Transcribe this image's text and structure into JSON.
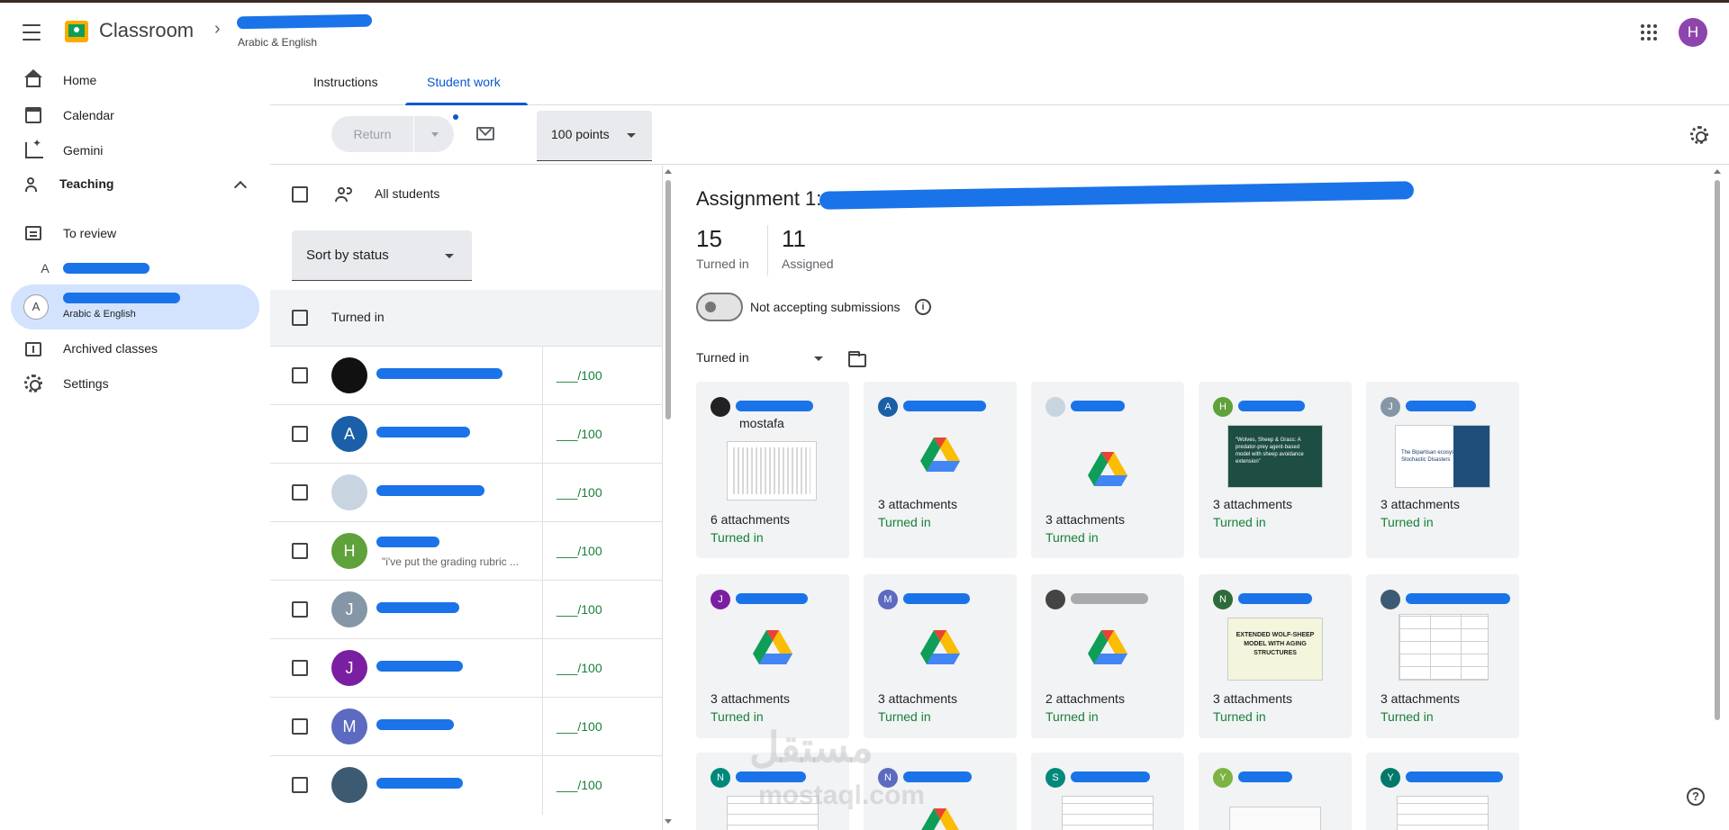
{
  "header": {
    "app_title": "Classroom",
    "class_subtitle": "Arabic & English",
    "avatar_initial": "H"
  },
  "sidebar": {
    "home": "Home",
    "calendar": "Calendar",
    "gemini": "Gemini",
    "teaching": "Teaching",
    "to_review": "To review",
    "class1_initial": "A",
    "class2_initial": "A",
    "class2_subtitle": "Arabic & English",
    "archived": "Archived classes",
    "settings": "Settings"
  },
  "tabs": {
    "instructions": "Instructions",
    "student_work": "Student work"
  },
  "toolbar": {
    "return_label": "Return",
    "points_label": "100 points"
  },
  "student_list": {
    "all_students": "All students",
    "sort_label": "Sort by status",
    "group_label": "Turned in",
    "rows": [
      {
        "initial": "",
        "color": "#111111",
        "grade": "___/100",
        "comment": ""
      },
      {
        "initial": "A",
        "color": "#1a5fa8",
        "grade": "___/100",
        "comment": ""
      },
      {
        "initial": "",
        "color": "#c8d4e0",
        "grade": "___/100",
        "comment": ""
      },
      {
        "initial": "H",
        "color": "#5fa13a",
        "grade": "___/100",
        "comment": "\"i've put the grading rubric ..."
      },
      {
        "initial": "J",
        "color": "#8596a6",
        "grade": "___/100",
        "comment": ""
      },
      {
        "initial": "J",
        "color": "#7b1fa2",
        "grade": "___/100",
        "comment": ""
      },
      {
        "initial": "M",
        "color": "#5c6bc0",
        "grade": "___/100",
        "comment": ""
      },
      {
        "initial": "",
        "color": "#3d5a73",
        "grade": "___/100",
        "comment": ""
      }
    ]
  },
  "assignment": {
    "title": "Assignment 1: Exte",
    "turned_in_count": "15",
    "turned_in_label": "Turned in",
    "assigned_count": "11",
    "assigned_label": "Assigned",
    "accepting_label": "Not accepting submissions",
    "filter_label": "Turned in",
    "cards": [
      {
        "initial": "",
        "color": "#222222",
        "name": "mostafa",
        "attachments": "6 attachments",
        "status": "Turned in"
      },
      {
        "initial": "A",
        "color": "#1a5fa8",
        "name": "",
        "attachments": "3 attachments",
        "status": "Turned in"
      },
      {
        "initial": "",
        "color": "#c8d4e0",
        "name": "",
        "attachments": "3 attachments",
        "status": "Turned in"
      },
      {
        "initial": "H",
        "color": "#5fa13a",
        "name": "",
        "attachments": "3 attachments",
        "status": "Turned in"
      },
      {
        "initial": "J",
        "color": "#8596a6",
        "name": "",
        "attachments": "3 attachments",
        "status": "Turned in"
      },
      {
        "initial": "J",
        "color": "#7b1fa2",
        "name": "",
        "attachments": "3 attachments",
        "status": "Turned in"
      },
      {
        "initial": "M",
        "color": "#5c6bc0",
        "name": "",
        "attachments": "3 attachments",
        "status": "Turned in"
      },
      {
        "initial": "",
        "color": "#444444",
        "name": "",
        "attachments": "2 attachments",
        "status": "Turned in"
      },
      {
        "initial": "N",
        "color": "#2e6b3a",
        "name": "",
        "attachments": "3 attachments",
        "status": "Turned in"
      },
      {
        "initial": "",
        "color": "#3d5a73",
        "name": "",
        "attachments": "3 attachments",
        "status": "Turned in"
      },
      {
        "initial": "N",
        "color": "#00897b",
        "name": "",
        "attachments": "",
        "status": ""
      },
      {
        "initial": "N",
        "color": "#5c6bc0",
        "name": "",
        "attachments": "",
        "status": ""
      },
      {
        "initial": "S",
        "color": "#00897b",
        "name": "",
        "attachments": "",
        "status": ""
      },
      {
        "initial": "Y",
        "color": "#7cb342",
        "name": "",
        "attachments": "",
        "status": ""
      },
      {
        "initial": "Y",
        "color": "#00796b",
        "name": "",
        "attachments": "",
        "status": ""
      }
    ],
    "thumb_text_1": "“Wolves, Sheep & Grass: A predator-prey agent-based model with sheep avoidance extension”",
    "thumb_text_2": "The Bipartisan ecosystem of Stochastic Disasters",
    "thumb_text_3": "EXTENDED WOLF-SHEEP MODEL WITH AGING STRUCTURES"
  },
  "watermark": {
    "line1": "مستقل",
    "line2": "mostaql.com"
  }
}
